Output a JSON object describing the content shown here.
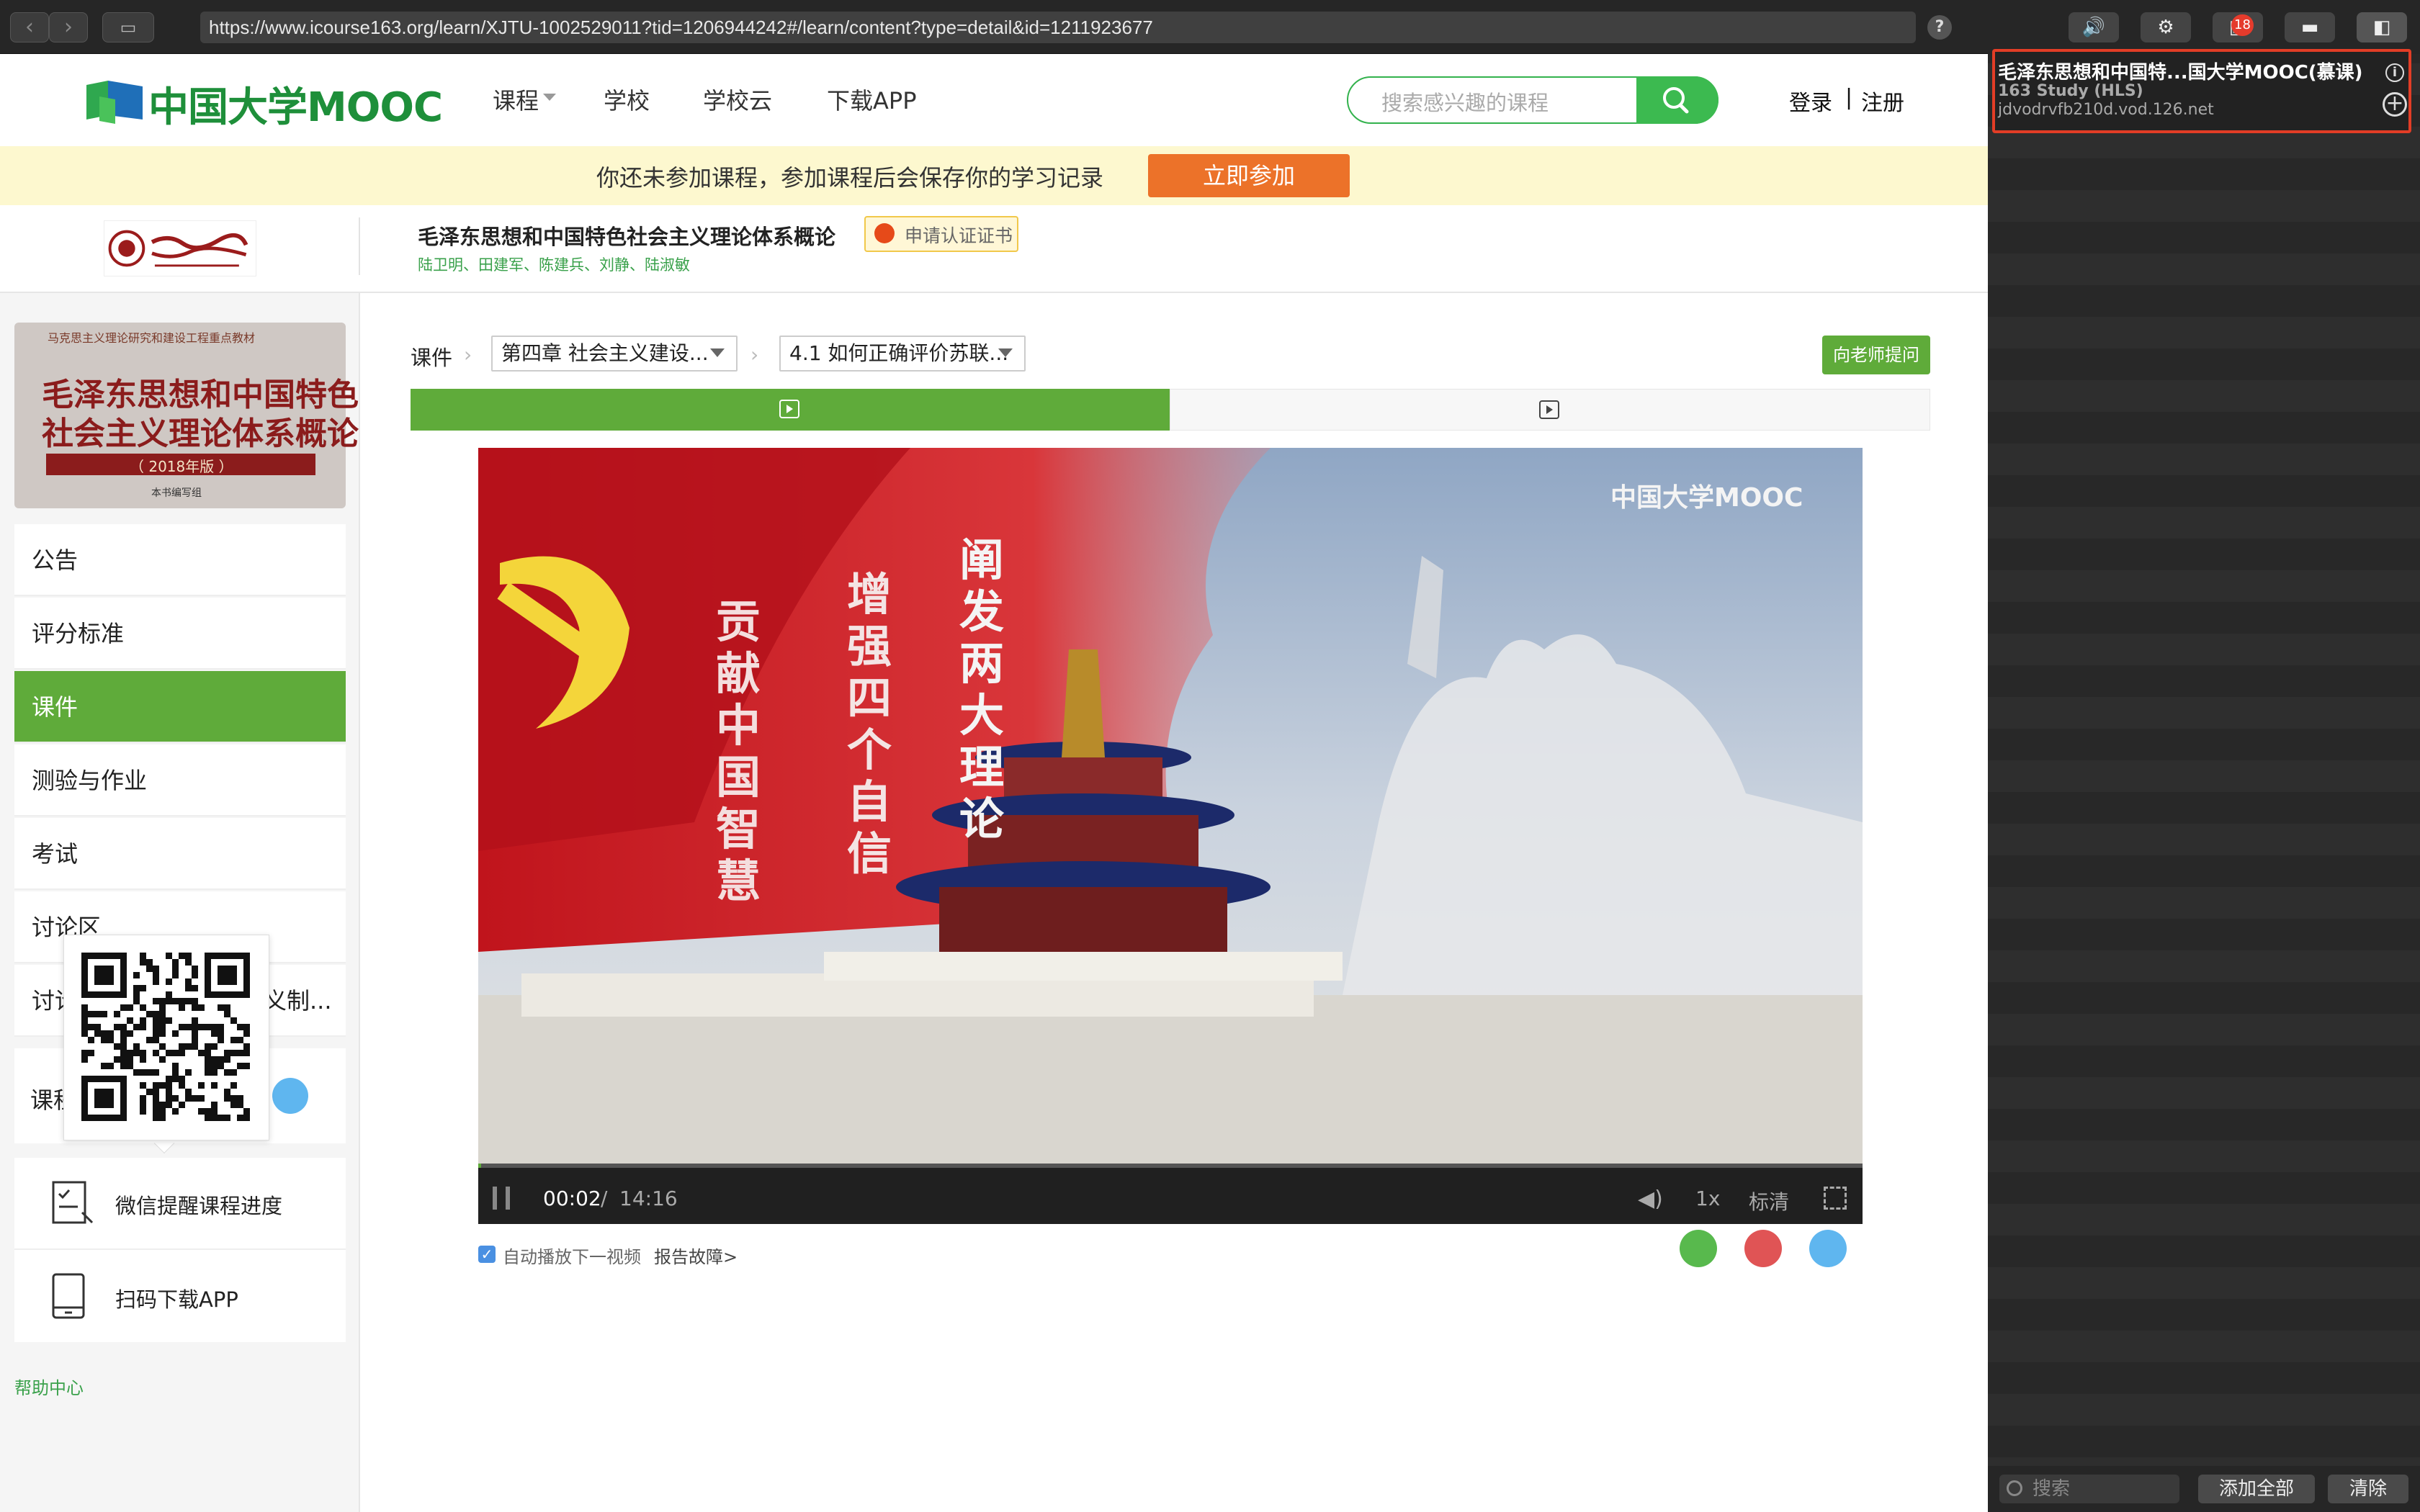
{
  "browser": {
    "url": "https://www.icourse163.org/learn/XJTU-1002529011?tid=1206944242#/learn/content?type=detail&id=1211923677",
    "help": "?",
    "badge_count": "18"
  },
  "media_panel": {
    "item_title": "毛泽东思想和中国特...国大学MOOC(慕课)",
    "item_subtitle": "163 Study (HLS)",
    "item_host": "jdvodrvfb210d.vod.126.net",
    "search_placeholder": "搜索",
    "add_all": "添加全部",
    "clear": "清除"
  },
  "header": {
    "logo_text": "中国大学MOOC",
    "nav": [
      "课程",
      "学校",
      "学校云",
      "下载APP"
    ],
    "search_placeholder": "搜索感兴趣的课程",
    "login": "登录",
    "separator": "|",
    "register": "注册"
  },
  "notice": {
    "text": "你还未参加课程，参加课程后会保存你的学习记录",
    "button": "立即参加"
  },
  "course": {
    "title": "毛泽东思想和中国特色社会主义理论体系概论",
    "teachers": "陆卫明、田建军、陈建兵、刘静、陆淑敏",
    "certificate": "申请认证证书"
  },
  "book": {
    "series": "马克思主义理论研究和建设工程重点教材",
    "line1": "毛泽东思想和中国特色",
    "line2": "社会主义理论体系概论",
    "edition": "（ 2018年版 ）",
    "publisher": "本书编写组"
  },
  "sidebar": {
    "items": [
      "公告",
      "评分标准",
      "课件",
      "测验与作业",
      "考试",
      "讨论区",
      "讨论",
      "义制..."
    ],
    "group_label": "课程",
    "wechat": "微信提醒课程进度",
    "app": "扫码下载APP",
    "help": "帮助中心"
  },
  "content": {
    "breadcrumb_root": "课件",
    "chapter": "第四章 社会主义建设...",
    "section": "4.1 如何正确评价苏联...",
    "ask_teacher": "向老师提问"
  },
  "video": {
    "watermark": "中国大学MOOC",
    "time_current": "00:02",
    "time_sep": "/",
    "time_total": "14:16",
    "progress": 0.002,
    "speed": "1x",
    "quality": "标清",
    "calligraphy": [
      "阐发两大理论",
      "增强四个自信",
      "贡献中国智慧"
    ]
  },
  "below_video": {
    "autoplay_label": "自动播放下一视频",
    "report": "报告故障>"
  },
  "colors": {
    "green": "#5fab3a",
    "orange": "#ec7229",
    "red_outline": "#e23d26"
  }
}
